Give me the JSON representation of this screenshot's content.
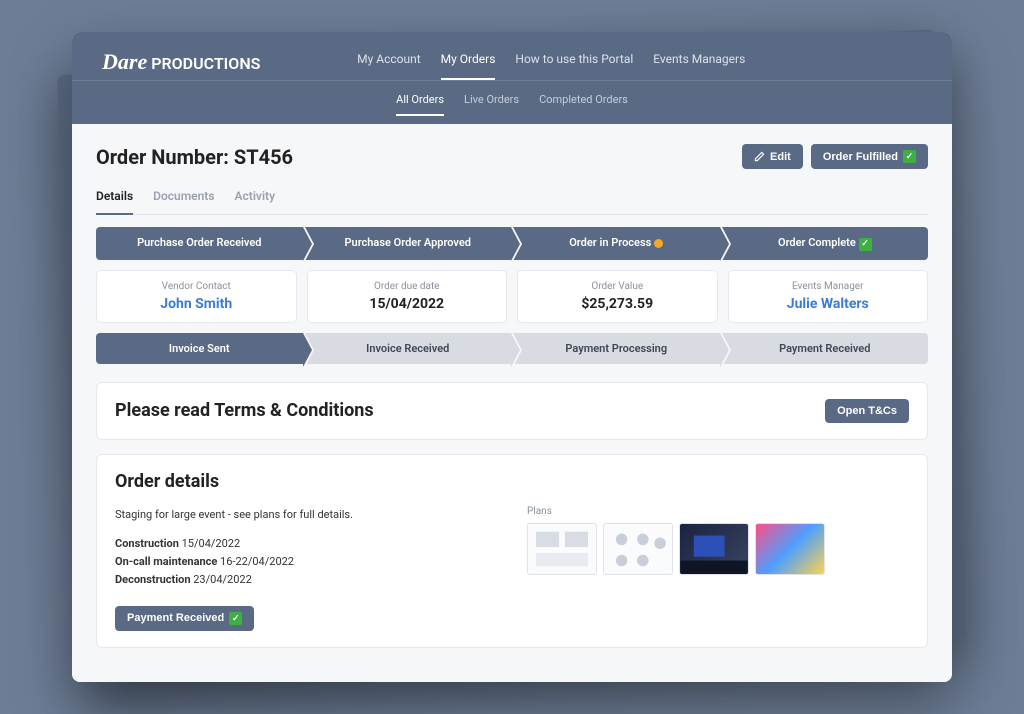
{
  "brand": {
    "script": "Dare",
    "text": "PRODUCTIONS"
  },
  "nav": {
    "items": [
      "My Account",
      "My Orders",
      "How to use this Portal",
      "Events Managers"
    ]
  },
  "subnav": {
    "items": [
      "All Orders",
      "Live Orders",
      "Completed Orders"
    ]
  },
  "page": {
    "title": "Order Number: ST456",
    "edit": "Edit",
    "fulfilled": "Order Fulfilled"
  },
  "tabs": [
    "Details",
    "Documents",
    "Activity"
  ],
  "progress1": [
    "Purchase Order Received",
    "Purchase Order Approved",
    "Order in Process",
    "Order Complete"
  ],
  "info": [
    {
      "label": "Vendor Contact",
      "value": "John Smith"
    },
    {
      "label": "Order due date",
      "value": "15/04/2022"
    },
    {
      "label": "Order Value",
      "value": "$25,273.59"
    },
    {
      "label": "Events Manager",
      "value": "Julie Walters"
    }
  ],
  "progress2": [
    "Invoice Sent",
    "Invoice Received",
    "Payment Processing",
    "Payment Received"
  ],
  "terms": {
    "title": "Please read Terms & Conditions",
    "button": "Open T&Cs"
  },
  "details": {
    "title": "Order details",
    "summary": "Staging for large event - see plans for full details.",
    "lines": [
      {
        "label": "Construction",
        "value": "15/04/2022"
      },
      {
        "label": "On-call maintenance",
        "value": "16-22/04/2022"
      },
      {
        "label": "Deconstruction",
        "value": "23/04/2022"
      }
    ],
    "plans_label": "Plans",
    "payment_received": "Payment Received"
  }
}
